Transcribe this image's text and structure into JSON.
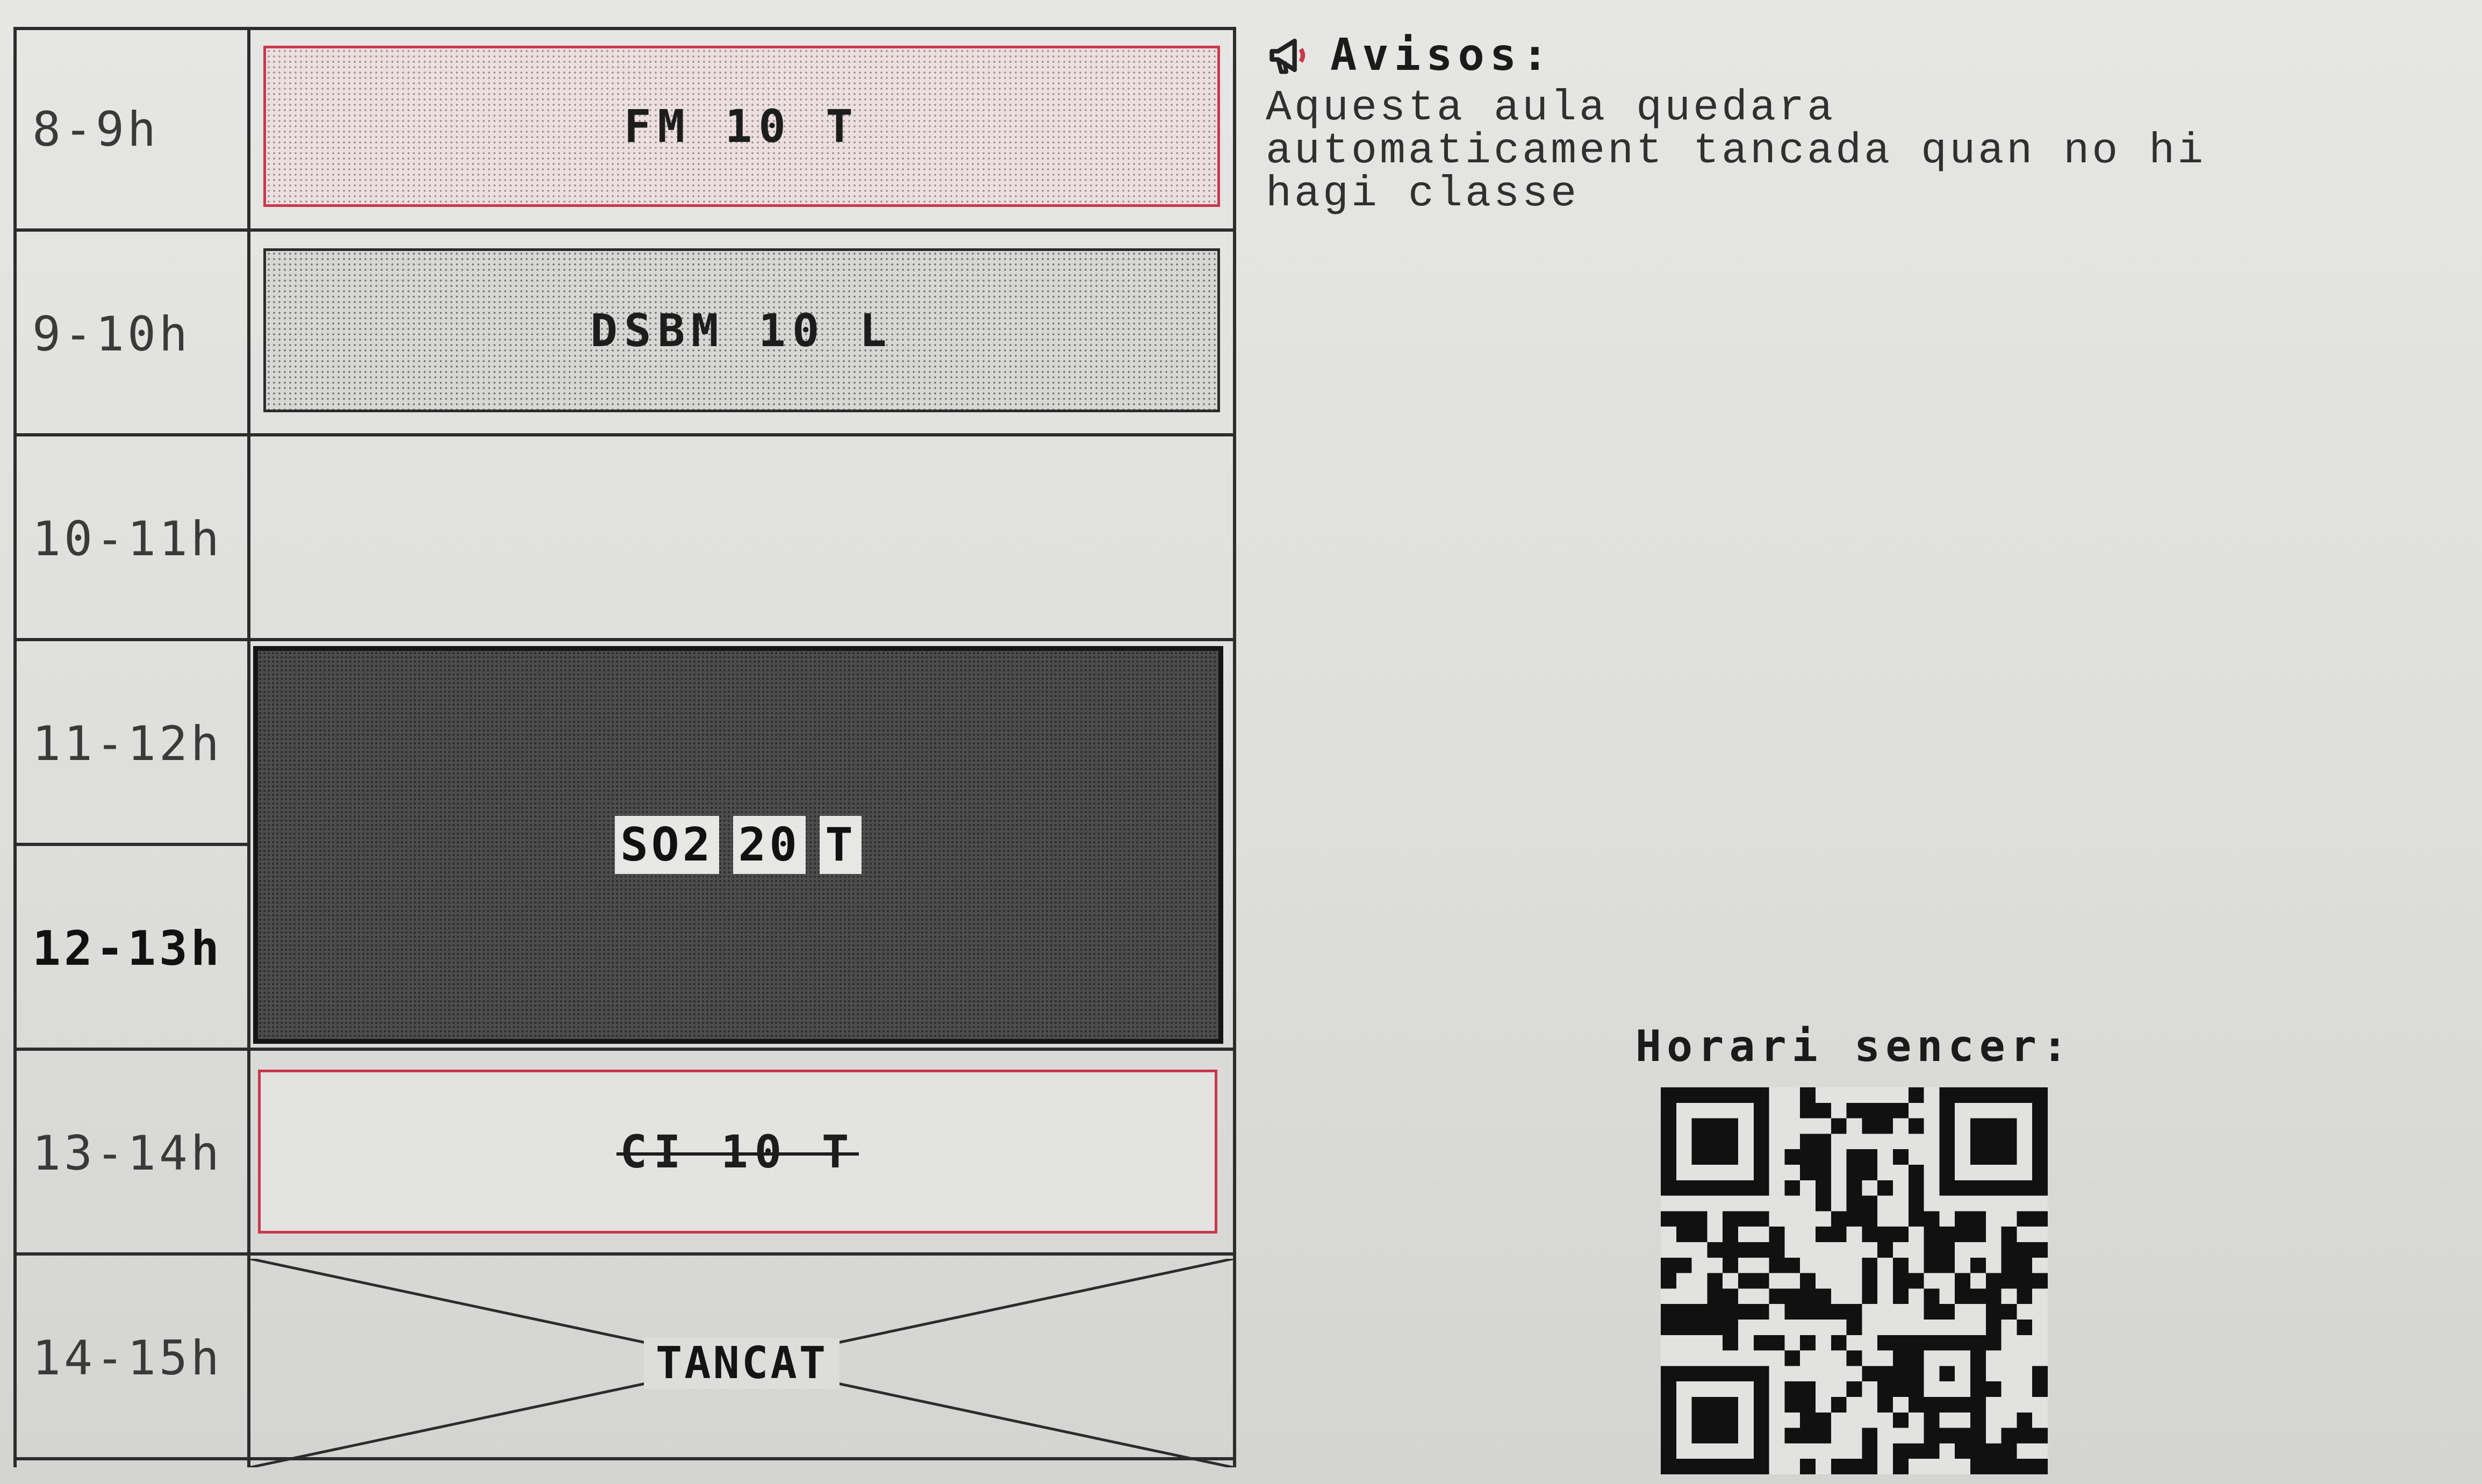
{
  "schedule": {
    "hours": [
      {
        "label": "8-9h",
        "current": false
      },
      {
        "label": "9-10h",
        "current": false
      },
      {
        "label": "10-11h",
        "current": false
      },
      {
        "label": "11-12h",
        "current": false
      },
      {
        "label": "12-13h",
        "current": true
      },
      {
        "label": "13-14h",
        "current": false
      },
      {
        "label": "14-15h",
        "current": false
      }
    ],
    "slots": [
      {
        "hour": "8-9h",
        "text": "FM 10 T",
        "style": "pink-dotted",
        "status": "scheduled"
      },
      {
        "hour": "9-10h",
        "text": "DSBM 10 L",
        "style": "gray-dotted",
        "status": "scheduled"
      },
      {
        "hour": "11-13h",
        "chips": [
          "SO2",
          "20",
          "T"
        ],
        "style": "dark",
        "status": "current"
      },
      {
        "hour": "13-14h",
        "text": "CI 10 T",
        "style": "red-outline",
        "status": "cancelled"
      },
      {
        "hour": "14-15h",
        "text": "TANCAT",
        "style": "crossed",
        "status": "closed"
      }
    ]
  },
  "notices": {
    "title": "Avisos:",
    "icon": "megaphone-icon",
    "lines": [
      "Aquesta aula quedara",
      "automaticament tancada quan no hi",
      "hagi classe"
    ]
  },
  "qr": {
    "title": "Horari sencer:",
    "icon": "qr-code"
  },
  "colors": {
    "accent_red": "#c9394a",
    "ink": "#1d1d1d",
    "paper": "#e2e2e0"
  }
}
